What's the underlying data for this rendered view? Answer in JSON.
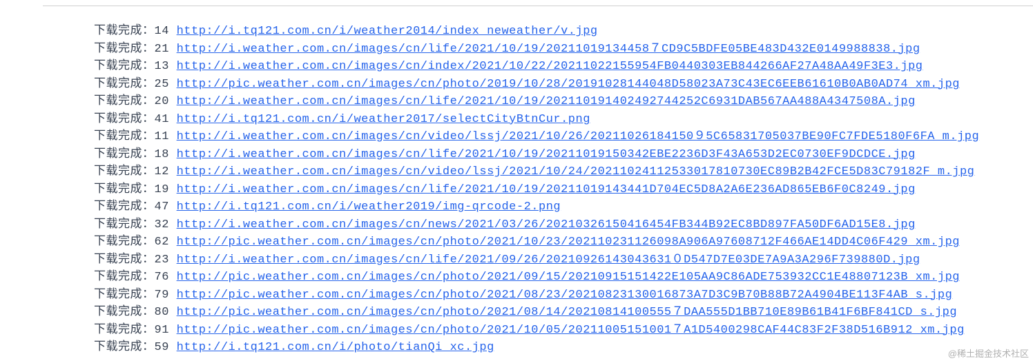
{
  "output": {
    "prefix_text": "下载完成：",
    "lines": [
      {
        "index": "14",
        "url": "http://i.tq121.com.cn/i/weather2014/index_neweather/v.jpg"
      },
      {
        "index": "21",
        "url": "http://i.weather.com.cn/images/cn/life/2021/10/19/20211019134458７CD9C5BDFE05BE483D432E0149988838.jpg"
      },
      {
        "index": "13",
        "url": "http://i.weather.com.cn/images/cn/index/2021/10/22/20211022155954FB0440303EB844266AF27A48AA49F3E3.jpg"
      },
      {
        "index": "25",
        "url": "http://pic.weather.com.cn/images/cn/photo/2019/10/28/20191028144048D58023A73C43EC6EEB61610B0AB0AD74_xm.jpg"
      },
      {
        "index": "20",
        "url": "http://i.weather.com.cn/images/cn/life/2021/10/19/202110191402492744252C6931DAB567AA488A4347508A.jpg"
      },
      {
        "index": "41",
        "url": "http://i.tq121.com.cn/i/weather2017/selectCityBtnCur.png"
      },
      {
        "index": "11",
        "url": "http://i.weather.com.cn/images/cn/video/lssj/2021/10/26/20211026184150９5C65831705037BE90FC7FDE5180F6FA_m.jpg"
      },
      {
        "index": "18",
        "url": "http://i.weather.com.cn/images/cn/life/2021/10/19/20211019150342EBE2236D3F43A653D2EC0730EF9DCDCE.jpg"
      },
      {
        "index": "12",
        "url": "http://i.weather.com.cn/images/cn/video/lssj/2021/10/24/20211024112533017810730EC89B2B42FCE5D83C79182F_m.jpg"
      },
      {
        "index": "19",
        "url": "http://i.weather.com.cn/images/cn/life/2021/10/19/20211019143441D704EC5D8A2A6E236AD865EB6F0C8249.jpg"
      },
      {
        "index": "47",
        "url": "http://i.tq121.com.cn/i/weather2019/img-qrcode-2.png"
      },
      {
        "index": "32",
        "url": "http://i.weather.com.cn/images/cn/news/2021/03/26/20210326150416454FB344B92EC8BD897FA50DF6AD15E8.jpg"
      },
      {
        "index": "62",
        "url": "http://pic.weather.com.cn/images/cn/photo/2021/10/23/202110231126098A906A97608712F466AE14DD4C06F429_xm.jpg"
      },
      {
        "index": "23",
        "url": "http://i.weather.com.cn/images/cn/life/2021/09/26/20210926143043631０D547D7E03DE7A9A3A296F739880D.jpg"
      },
      {
        "index": "76",
        "url": "http://pic.weather.com.cn/images/cn/photo/2021/09/15/20210915151422E105AA9C86ADE753932CC1E48807123B_xm.jpg"
      },
      {
        "index": "79",
        "url": "http://pic.weather.com.cn/images/cn/photo/2021/08/23/20210823130016873A7D3C9B70B88B72A4904BE113F4AB_s.jpg"
      },
      {
        "index": "80",
        "url": "http://pic.weather.com.cn/images/cn/photo/2021/08/14/20210814100555７DAA555D1BB710E89B61B41F6BF841CD_s.jpg"
      },
      {
        "index": "91",
        "url": "http://pic.weather.com.cn/images/cn/photo/2021/10/05/20211005151001７A1D5400298CAF44C83F2F38D516B912_xm.jpg"
      },
      {
        "index": "59",
        "url": "http://i.tq121.com.cn/i/photo/tianQi_xc.jpg"
      }
    ]
  },
  "watermark": "@稀土掘金技术社区"
}
